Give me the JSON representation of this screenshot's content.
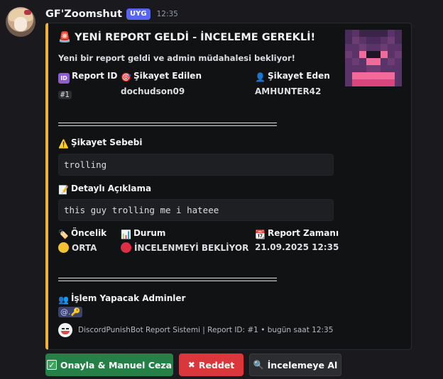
{
  "message": {
    "username": "GF'Zoomshut",
    "badge": "UYG",
    "timestamp": "12:35"
  },
  "embed": {
    "accent_color": "#f0b232",
    "title": "🚨 YENİ REPORT GELDİ - İNCELEME GEREKLİ!",
    "description": "Yeni bir report geldi ve admin müdahalesi bekliyor!",
    "fields_row1": [
      {
        "name": "Report ID",
        "value": "#1"
      },
      {
        "name": "Şikayet Edilen",
        "value": "dochudson09"
      },
      {
        "name": "Şikayet Eden",
        "value": "AMHUNTER42"
      }
    ],
    "reason_label": "Şikayet Sebebi",
    "reason_value": "trolling",
    "detail_label": "Detaylı Açıklama",
    "detail_value": "this guy trolling me i hateee",
    "fields_row2": [
      {
        "name": "Öncelik",
        "value": "ORTA"
      },
      {
        "name": "Durum",
        "value": "İNCELENMEYİ BEKLİYOR"
      },
      {
        "name": "Report Zamanı",
        "value": "21.09.2025 12:35"
      }
    ],
    "admins_label": "İşlem Yapacak Adminler",
    "admins_value": "@.🔑",
    "footer": "DiscordPunishBot Report Sistemi | Report ID: #1 • bugün saat 12:35"
  },
  "buttons": {
    "approve": "Onayla & Manuel Ceza",
    "reject": "Reddet",
    "review": "İncelemeye Al"
  },
  "icons": {
    "siren": "siren-icon",
    "id": "id-icon",
    "target": "target-icon",
    "user": "user-icon",
    "warning": "warning-icon",
    "memo": "memo-icon",
    "label": "label-icon",
    "chart": "chart-icon",
    "calendar": "calendar-icon",
    "users": "users-icon",
    "check": "check-icon",
    "cross": "cross-icon",
    "search": "search-icon"
  },
  "colors": {
    "priority_dot": "#f5c232",
    "status_dot": "#dd2e44",
    "approve_button": "#248046",
    "reject_button": "#da373c",
    "badge": "#5865f2"
  }
}
